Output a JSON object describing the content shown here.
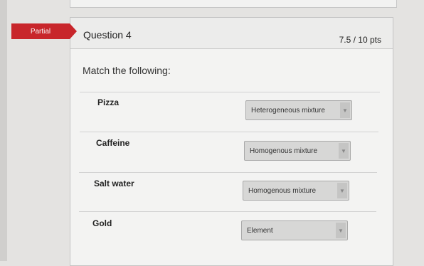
{
  "badge": {
    "label": "Partial"
  },
  "question": {
    "title": "Question 4",
    "points": "7.5 / 10 pts",
    "prompt": "Match the following:"
  },
  "matches": [
    {
      "term": "Pizza",
      "answer": "Heterogeneous mixture"
    },
    {
      "term": "Caffeine",
      "answer": "Homogenous mixture"
    },
    {
      "term": "Salt water",
      "answer": "Homogenous mixture"
    },
    {
      "term": "Gold",
      "answer": "Element"
    }
  ],
  "colors": {
    "badge": "#c8262b",
    "card": "#f3f3f2",
    "select": "#d7d7d6"
  },
  "icons": {
    "dropdown": "chevron-down-icon"
  }
}
